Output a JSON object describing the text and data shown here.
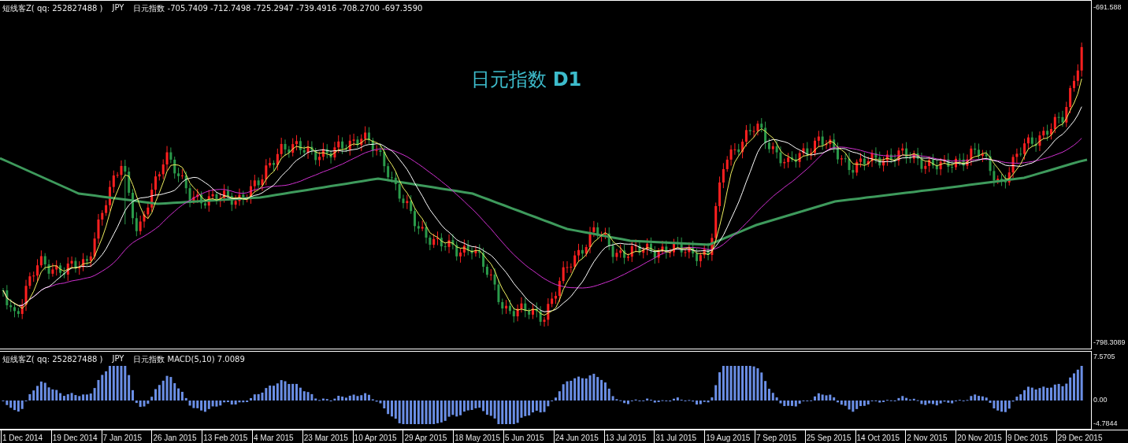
{
  "main_chart": {
    "header": [
      "短线客Z( qq: 252827488 )",
      "JPY",
      "日元指数 -705.7409 -712.7498 -725.2947 -739.4916 -708.2700 -697.3590"
    ],
    "title": "日元指数 **D1**",
    "price_axis": [
      "-691.588",
      "-798.3089"
    ]
  },
  "macd_panel": {
    "header": [
      "短线客Z( qq: 252827488 )",
      "JPY",
      "日元指数 MACD(5,10)  7.0089"
    ],
    "axis": [
      "7.5705",
      "0.00",
      "-4.7844"
    ]
  },
  "date_axis": [
    "1 Dec 2014",
    "19 Dec 2014",
    "7 Jan 2015",
    "26 Jan 2015",
    "13 Feb 2015",
    "4 Mar 2015",
    "23 Mar 2015",
    "10 Apr 2015",
    "29 Apr 2015",
    "18 May 2015",
    "5 Jun 2015",
    "24 Jun 2015",
    "13 Jul 2015",
    "31 Jul 2015",
    "19 Aug 2015",
    "7 Sep 2015",
    "25 Sep 2015",
    "14 Oct 2015",
    "2 Nov 2015",
    "20 Nov 2015",
    "9 Dec 2015",
    "29 Dec 2015"
  ]
}
